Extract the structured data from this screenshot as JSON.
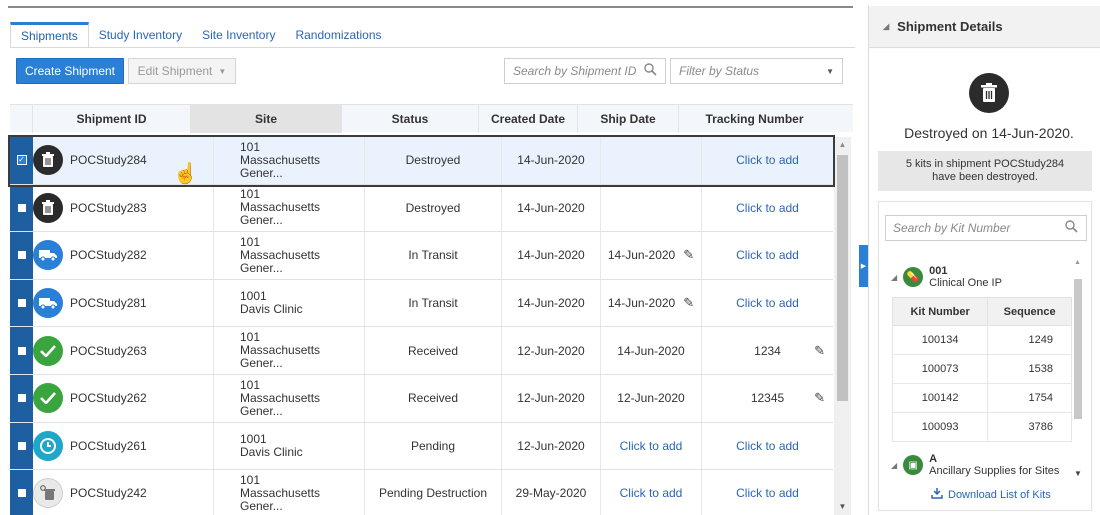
{
  "tabs": [
    {
      "label": "Shipments",
      "active": true
    },
    {
      "label": "Study Inventory",
      "active": false
    },
    {
      "label": "Site Inventory",
      "active": false
    },
    {
      "label": "Randomizations",
      "active": false
    }
  ],
  "toolbar": {
    "create_label": "Create Shipment",
    "edit_label": "Edit Shipment",
    "search_placeholder": "Search by Shipment ID",
    "filter_placeholder": "Filter by Status"
  },
  "table": {
    "columns": [
      "Shipment ID",
      "Site",
      "Status",
      "Created Date",
      "Ship Date",
      "Tracking Number"
    ],
    "rows": [
      {
        "id": "POCStudy284",
        "site_num": "101",
        "site_name": "Massachusetts Gener...",
        "status": "Destroyed",
        "created": "14-Jun-2020",
        "ship": "",
        "tracking": "Click to add",
        "icon": "trash-icon",
        "selected": true
      },
      {
        "id": "POCStudy283",
        "site_num": "101",
        "site_name": "Massachusetts Gener...",
        "status": "Destroyed",
        "created": "14-Jun-2020",
        "ship": "",
        "tracking": "Click to add",
        "icon": "trash-icon",
        "selected": false
      },
      {
        "id": "POCStudy282",
        "site_num": "101",
        "site_name": "Massachusetts Gener...",
        "status": "In Transit",
        "created": "14-Jun-2020",
        "ship": "14-Jun-2020",
        "tracking": "Click to add",
        "icon": "truck-icon",
        "selected": false
      },
      {
        "id": "POCStudy281",
        "site_num": "1001",
        "site_name": "Davis Clinic",
        "status": "In Transit",
        "created": "14-Jun-2020",
        "ship": "14-Jun-2020",
        "tracking": "Click to add",
        "icon": "truck-icon",
        "selected": false
      },
      {
        "id": "POCStudy263",
        "site_num": "101",
        "site_name": "Massachusetts Gener...",
        "status": "Received",
        "created": "12-Jun-2020",
        "ship": "14-Jun-2020",
        "tracking": "1234",
        "icon": "check-icon",
        "selected": false
      },
      {
        "id": "POCStudy262",
        "site_num": "101",
        "site_name": "Massachusetts Gener...",
        "status": "Received",
        "created": "12-Jun-2020",
        "ship": "12-Jun-2020",
        "tracking": "12345",
        "icon": "check-icon",
        "selected": false
      },
      {
        "id": "POCStudy261",
        "site_num": "1001",
        "site_name": "Davis Clinic",
        "status": "Pending",
        "created": "12-Jun-2020",
        "ship": "Click to add",
        "tracking": "Click to add",
        "icon": "clock-icon",
        "selected": false
      },
      {
        "id": "POCStudy242",
        "site_num": "101",
        "site_name": "Massachusetts Gener...",
        "status": "Pending Destruction",
        "created": "29-May-2020",
        "ship": "Click to add",
        "tracking": "Click to add",
        "icon": "pending-trash-icon",
        "selected": false
      }
    ]
  },
  "details": {
    "title": "Shipment Details",
    "destroyed_on": "Destroyed on 14-Jun-2020.",
    "notice_line1": "5 kits in shipment POCStudy284",
    "notice_line2": "have been destroyed.",
    "kit_search_placeholder": "Search by Kit Number",
    "groups": [
      {
        "code": "001",
        "name": "Clinical One IP"
      },
      {
        "code": "A",
        "name": "Ancillary Supplies for Sites"
      }
    ],
    "kit_columns": [
      "Kit Number",
      "Sequence"
    ],
    "kits": [
      {
        "kit": "100134",
        "seq": "1249"
      },
      {
        "kit": "100073",
        "seq": "1538"
      },
      {
        "kit": "100142",
        "seq": "1754"
      },
      {
        "kit": "100093",
        "seq": "3786"
      }
    ],
    "download_label": "Download List of Kits"
  },
  "colors": {
    "accent": "#2a7fd6",
    "selection_bar": "#1d5fa0",
    "destroyed": "#2b2b2b",
    "in_transit": "#2a7fd6",
    "received": "#3aa53e",
    "pending": "#1ea7c9",
    "kit_group": "#3a8a3d"
  }
}
